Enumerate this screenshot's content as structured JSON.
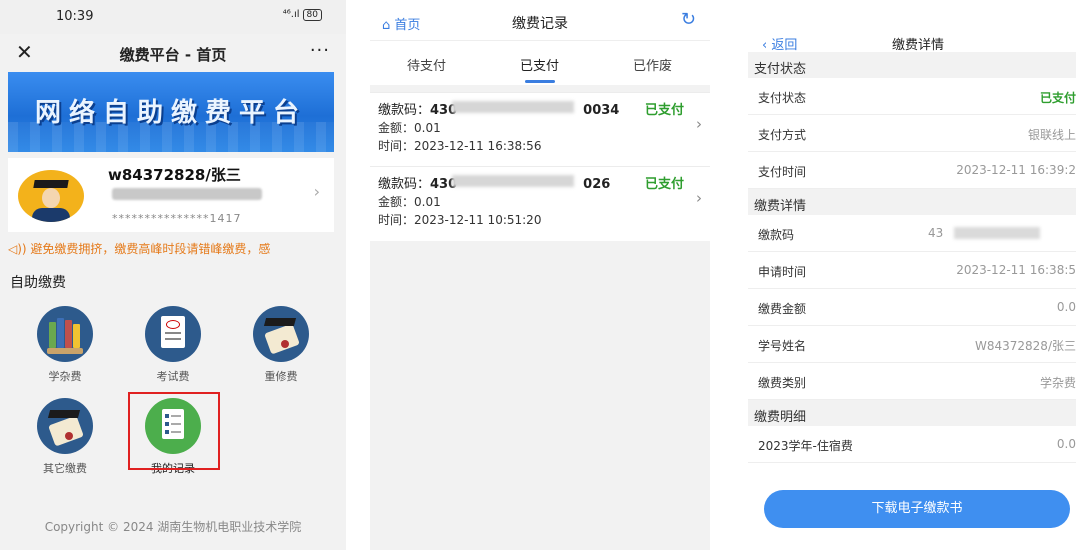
{
  "panel1": {
    "status": {
      "time": "10:39",
      "signal": "⁴⁶.ıl",
      "battery": "80"
    },
    "nav": {
      "close": "✕",
      "title": "缴费平台 - 首页",
      "more": "···"
    },
    "banner": "网络自助缴费平台",
    "user": {
      "name": "w84372828/张三",
      "id": "***************1417",
      "arrow": "›"
    },
    "notice": "◁)) 避免缴费拥挤，缴费高峰时段请错峰缴费，感",
    "section_title": "自助缴费",
    "items": [
      {
        "label": "学杂费"
      },
      {
        "label": "考试费"
      },
      {
        "label": "重修费"
      },
      {
        "label": "其它缴费"
      },
      {
        "label": "我的记录"
      }
    ],
    "footer": "Copyright © 2024  湖南生物机电职业技术学院"
  },
  "panel2": {
    "nav": {
      "home": "⌂ 首页",
      "title": "缴费记录",
      "refresh": "↻"
    },
    "tabs": [
      {
        "label": "待支付"
      },
      {
        "label": "已支付"
      },
      {
        "label": "已作废"
      }
    ],
    "records": [
      {
        "code_label": "缴款码：",
        "code_prefix": "430",
        "code_suffix": "0034",
        "status": "已支付",
        "amount": "金额：0.01",
        "time": "时间：2023-12-11 16:38:56"
      },
      {
        "code_label": "缴款码：",
        "code_prefix": "430",
        "code_suffix": "026",
        "status": "已支付",
        "amount": "金额：0.01",
        "time": "时间：2023-12-11 10:51:20"
      }
    ]
  },
  "panel3": {
    "nav": {
      "back": "‹ 返回",
      "title": "缴费详情"
    },
    "pay_section": "支付状态",
    "pay_rows": [
      {
        "k": "支付状态",
        "v": "已支付"
      },
      {
        "k": "支付方式",
        "v": "银联线上"
      },
      {
        "k": "支付时间",
        "v": "2023-12-11 16:39:2"
      }
    ],
    "detail_section": "缴费详情",
    "detail_rows": [
      {
        "k": "缴款码",
        "v": "43"
      },
      {
        "k": "申请时间",
        "v": "2023-12-11 16:38:5"
      },
      {
        "k": "缴费金额",
        "v": "0.0"
      },
      {
        "k": "学号姓名",
        "v": "W84372828/张三"
      },
      {
        "k": "缴费类别",
        "v": "学杂费"
      }
    ],
    "items_section": "缴费明细",
    "item_rows": [
      {
        "k": "2023学年-住宿费",
        "v": "0.0"
      }
    ],
    "download": "下载电子缴款书"
  },
  "colors": {
    "accent": "#3a7de0",
    "success": "#2f9e2f",
    "notice": "#e57a1a",
    "highlight": "#e02020"
  }
}
